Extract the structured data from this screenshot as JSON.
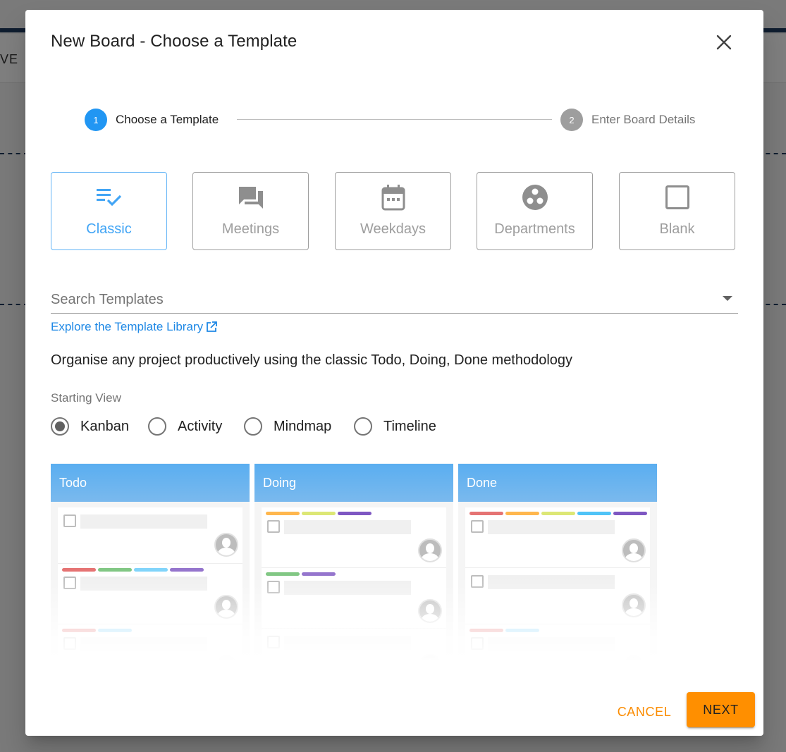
{
  "background": {
    "header_text": "VE"
  },
  "dialog": {
    "title": "New Board - Choose a Template",
    "close_icon": "close-icon"
  },
  "stepper": {
    "steps": [
      {
        "number": "1",
        "label": "Choose a Template",
        "state": "active"
      },
      {
        "number": "2",
        "label": "Enter Board Details",
        "state": "inactive"
      }
    ]
  },
  "templates": [
    {
      "label": "Classic",
      "icon": "checklist-icon",
      "selected": true
    },
    {
      "label": "Meetings",
      "icon": "forum-icon",
      "selected": false
    },
    {
      "label": "Weekdays",
      "icon": "calendar-icon",
      "selected": false
    },
    {
      "label": "Departments",
      "icon": "workspaces-icon",
      "selected": false
    },
    {
      "label": "Blank",
      "icon": "square-outline-icon",
      "selected": false
    }
  ],
  "search": {
    "placeholder": "Search Templates",
    "value": ""
  },
  "explore_link": "Explore the Template Library",
  "description": "Organise any project productively using the classic Todo, Doing, Done methodology",
  "starting_view": {
    "label": "Starting View",
    "options": [
      {
        "label": "Kanban",
        "selected": true
      },
      {
        "label": "Activity",
        "selected": false
      },
      {
        "label": "Mindmap",
        "selected": false
      },
      {
        "label": "Timeline",
        "selected": false
      }
    ]
  },
  "preview": {
    "columns": [
      "Todo",
      "Doing",
      "Done"
    ]
  },
  "actions": {
    "cancel": "CANCEL",
    "next": "NEXT"
  },
  "colors": {
    "accent": "#2196f3",
    "primary_button": "#ff8f00",
    "cancel_text": "#fb8c00",
    "label_colors": [
      "#e57373",
      "#81c784",
      "#81d4fa",
      "#9575cd",
      "#ffb74d",
      "#dce775",
      "#4fc3f7",
      "#7e57c2"
    ]
  }
}
